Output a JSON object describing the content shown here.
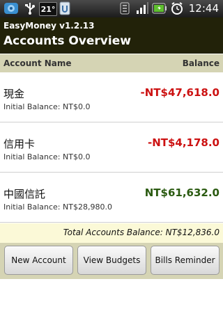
{
  "status_bar": {
    "time": "12:44",
    "temperature": "21°",
    "icons": [
      "app-icon",
      "usb-icon",
      "temperature-icon",
      "power-icon",
      "data-signal-icon",
      "cell-signal-icon",
      "battery-icon",
      "alarm-icon"
    ]
  },
  "app": {
    "name": "EasyMoney v1.2.13",
    "title": "Accounts Overview"
  },
  "columns": {
    "account_name": "Account Name",
    "balance": "Balance"
  },
  "accounts": [
    {
      "name": "現金",
      "initial_balance": "Initial Balance: NT$0.0",
      "balance": "-NT$47,618.0",
      "balance_color": "#cc1111"
    },
    {
      "name": "信用卡",
      "initial_balance": "Initial Balance: NT$0.0",
      "balance": "-NT$4,178.0",
      "balance_color": "#cc1111"
    },
    {
      "name": "中國信託",
      "initial_balance": "Initial Balance: NT$28,980.0",
      "balance": "NT$61,632.0",
      "balance_color": "#2a5a10"
    }
  ],
  "total": {
    "text": "Total Accounts Balance: NT$12,836.0"
  },
  "buttons": {
    "new_account": "New Account",
    "view_budgets": "View Budgets",
    "bills_reminder": "Bills Reminder"
  },
  "colors": {
    "title_bar": "#222209",
    "header_bar": "#d5d4b4",
    "total_bar": "#fbf9d7",
    "negative": "#cc1111",
    "positive": "#2a5a10"
  }
}
